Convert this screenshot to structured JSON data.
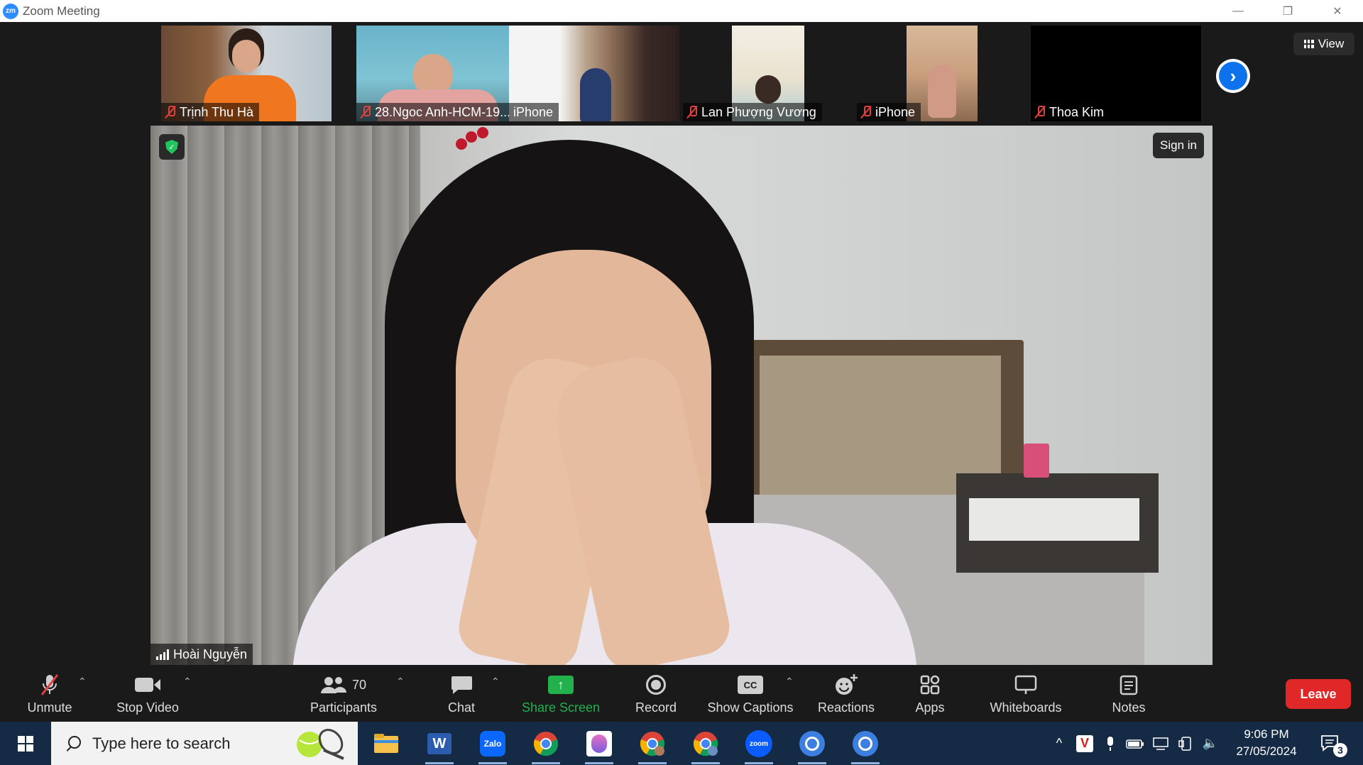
{
  "window": {
    "logo": "zm",
    "title": "Zoom Meeting",
    "controls": [
      "—",
      "❐",
      "✕"
    ]
  },
  "thumbnails": [
    {
      "name": "Trịnh Thu Hà",
      "muted": true
    },
    {
      "name": "28.Ngoc Anh-HCM-19...",
      "muted": true
    },
    {
      "name": "iPhone",
      "muted": false
    },
    {
      "name": "Lan Phượng Vương",
      "muted": true
    },
    {
      "name": "iPhone",
      "muted": true
    },
    {
      "name": "Thoa Kim",
      "muted": true
    }
  ],
  "view_button": {
    "label": "View",
    "icon": "grid-icon"
  },
  "next_icon": "›",
  "main_video": {
    "speaker": "Hoài Nguyễn",
    "signin_label": "Sign in",
    "shield_icon": "✓"
  },
  "toolbar": {
    "unmute": "Unmute",
    "stop_video": "Stop Video",
    "participants": "Participants",
    "participants_count": "70",
    "chat": "Chat",
    "share_screen": "Share Screen",
    "record": "Record",
    "show_captions": "Show Captions",
    "captions_icon": "CC",
    "reactions": "Reactions",
    "apps": "Apps",
    "whiteboards": "Whiteboards",
    "notes": "Notes",
    "leave": "Leave",
    "caret": "⌃",
    "share_icon_glyph": "↑"
  },
  "taskbar": {
    "search_placeholder": "Type here to search",
    "apps": [
      "file-explorer",
      "word",
      "zalo",
      "chrome",
      "app",
      "chrome",
      "chrome",
      "zoom",
      "chrome",
      "chrome"
    ],
    "app_labels": {
      "word": "W",
      "zalo": "Zalo",
      "zoom": "zoom"
    },
    "time": "9:06 PM",
    "date": "27/05/2024",
    "notification_count": "3",
    "tray_glyphs": {
      "overflow": "^",
      "v_app": "V",
      "speaker": "🔈"
    }
  },
  "colors": {
    "accent_blue": "#0e72ed",
    "share_green": "#23b14d",
    "leave_red": "#e02828",
    "muted_red": "#e04040",
    "taskbar": "#152a45"
  }
}
